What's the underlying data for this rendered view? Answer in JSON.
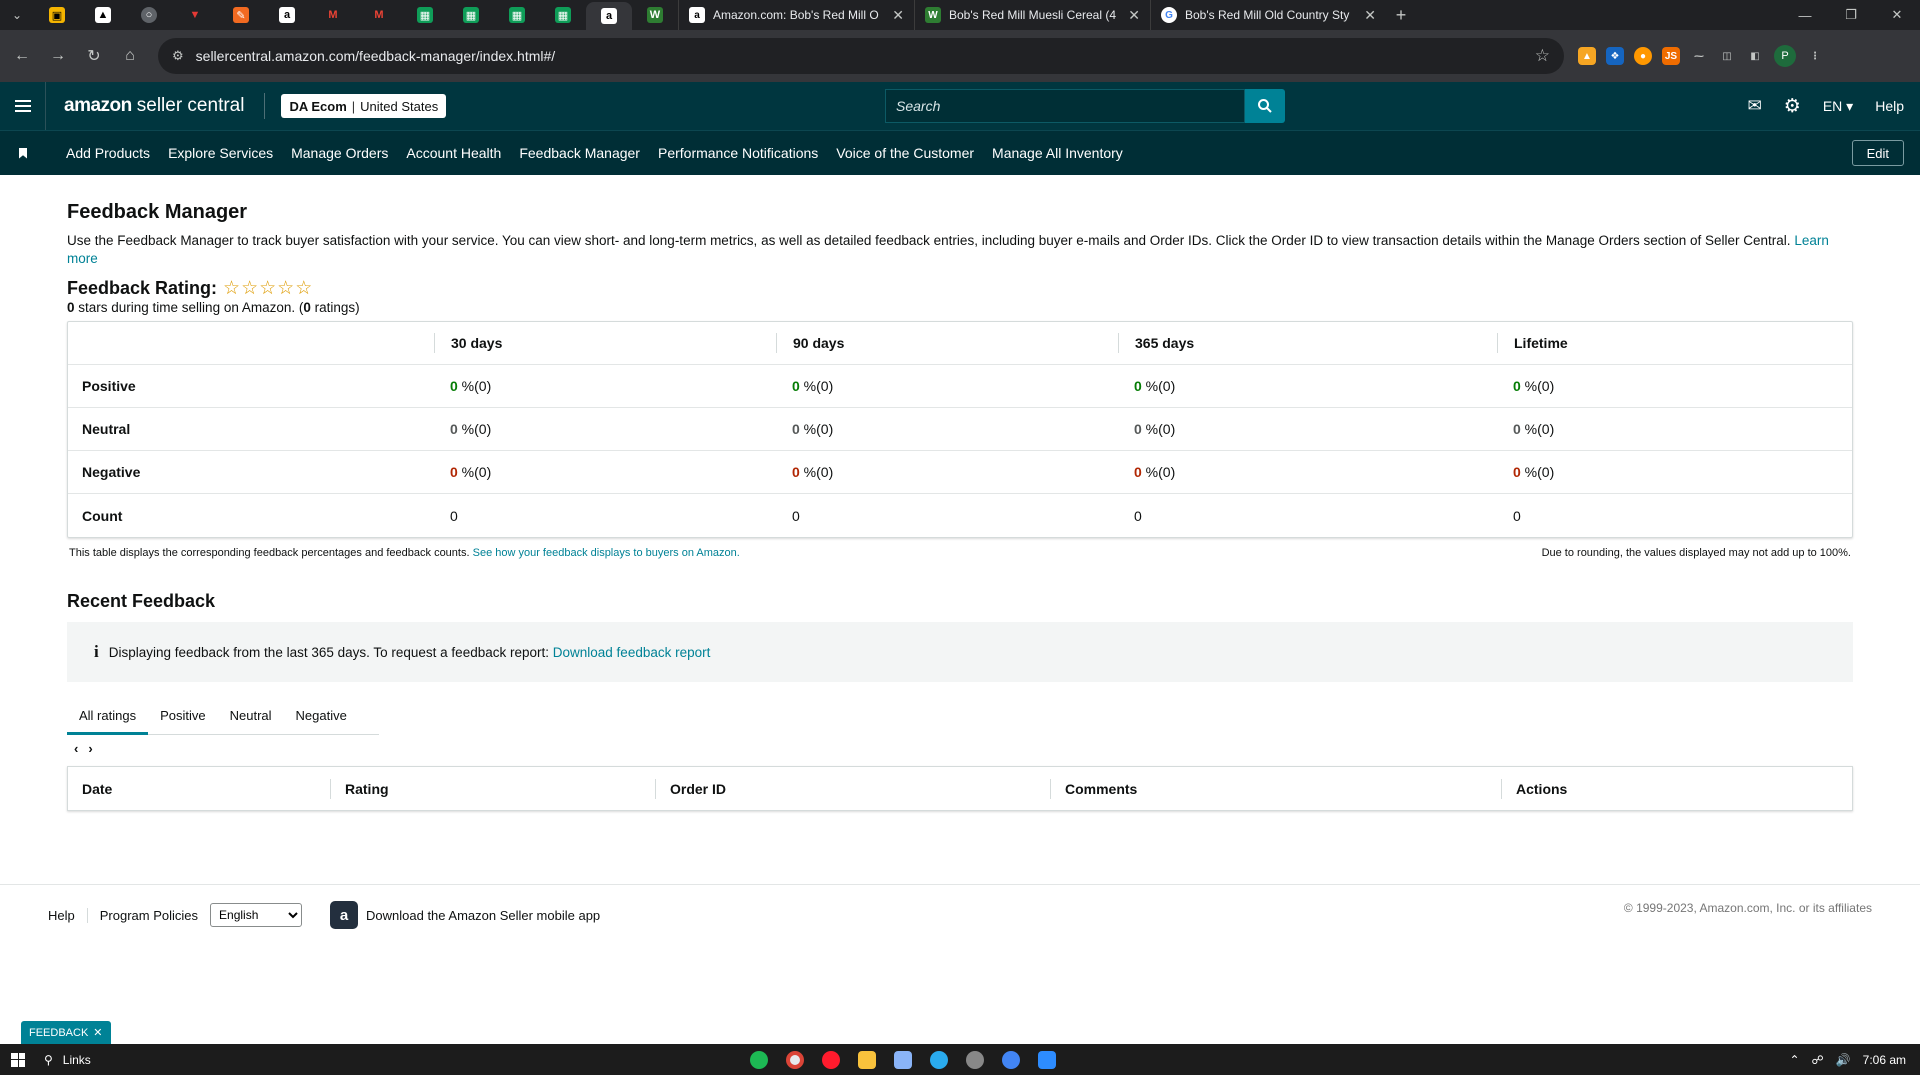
{
  "browser": {
    "tabs": [
      {
        "title": "Amazon.com: Bob's Red Mill O",
        "icon": "amazon-favicon"
      },
      {
        "title": "Bob's Red Mill Muesli Cereal (4",
        "icon": "w-favicon"
      },
      {
        "title": "Bob's Red Mill Old Country Sty",
        "icon": "google-favicon"
      }
    ],
    "url": "sellercentral.amazon.com/feedback-manager/index.html#/",
    "profile_initial": "P"
  },
  "header": {
    "logo_brand": "amazon",
    "logo_product": "seller central",
    "account_name": "DA Ecom",
    "account_region": "United States",
    "search_placeholder": "Search",
    "language": "EN",
    "help": "Help"
  },
  "nav": {
    "links": [
      "Add Products",
      "Explore Services",
      "Manage Orders",
      "Account Health",
      "Feedback Manager",
      "Performance Notifications",
      "Voice of the Customer",
      "Manage All Inventory"
    ],
    "edit_label": "Edit"
  },
  "page": {
    "title": "Feedback Manager",
    "description": "Use the Feedback Manager to track buyer satisfaction with your service. You can view short- and long-term metrics, as well as detailed feedback entries, including buyer e-mails and Order IDs. Click the Order ID to view transaction details within the Manage Orders section of Seller Central.",
    "learn_more": "Learn more",
    "rating_title": "Feedback Rating:",
    "rating_stars": 0,
    "rating_sub_stars": "0",
    "rating_sub_text": " stars during time selling on Amazon. (",
    "rating_sub_count": "0",
    "rating_sub_end": " ratings)"
  },
  "metrics": {
    "columns": [
      "30 days",
      "90 days",
      "365 days",
      "Lifetime"
    ],
    "rows": [
      {
        "label": "Positive",
        "values": [
          {
            "pct": "0",
            "rest": " %(0)"
          },
          {
            "pct": "0",
            "rest": " %(0)"
          },
          {
            "pct": "0",
            "rest": " %(0)"
          },
          {
            "pct": "0",
            "rest": " %(0)"
          }
        ]
      },
      {
        "label": "Neutral",
        "values": [
          {
            "pct": "0",
            "rest": " %(0)"
          },
          {
            "pct": "0",
            "rest": " %(0)"
          },
          {
            "pct": "0",
            "rest": " %(0)"
          },
          {
            "pct": "0",
            "rest": " %(0)"
          }
        ]
      },
      {
        "label": "Negative",
        "values": [
          {
            "pct": "0",
            "rest": " %(0)"
          },
          {
            "pct": "0",
            "rest": " %(0)"
          },
          {
            "pct": "0",
            "rest": " %(0)"
          },
          {
            "pct": "0",
            "rest": " %(0)"
          }
        ]
      },
      {
        "label": "Count",
        "counts": [
          "0",
          "0",
          "0",
          "0"
        ]
      }
    ],
    "note_left": "This table displays the corresponding feedback percentages and feedback counts.",
    "note_link": "See how your feedback displays to buyers on Amazon.",
    "note_right": "Due to rounding, the values displayed may not add up to 100%.",
    "colors": {
      "positive": "#067d06",
      "negative": "#b12704"
    }
  },
  "recent": {
    "title": "Recent Feedback",
    "info_text": "Displaying feedback from the last 365 days. To request a feedback report:",
    "info_link": "Download feedback report",
    "tabs": [
      "All ratings",
      "Positive",
      "Neutral",
      "Negative"
    ],
    "active_tab": "All ratings",
    "table_headers": [
      "Date",
      "Rating",
      "Order ID",
      "Comments",
      "Actions"
    ]
  },
  "footer": {
    "help": "Help",
    "policies": "Program Policies",
    "language_selected": "English",
    "app_text": "Download the Amazon Seller mobile app",
    "copyright": "© 1999-2023, Amazon.com, Inc. or its affiliates",
    "feedback_badge": "FEEDBACK"
  },
  "taskbar": {
    "search_label": "Links",
    "time": "7:06 am"
  },
  "accent_color": "#008296"
}
